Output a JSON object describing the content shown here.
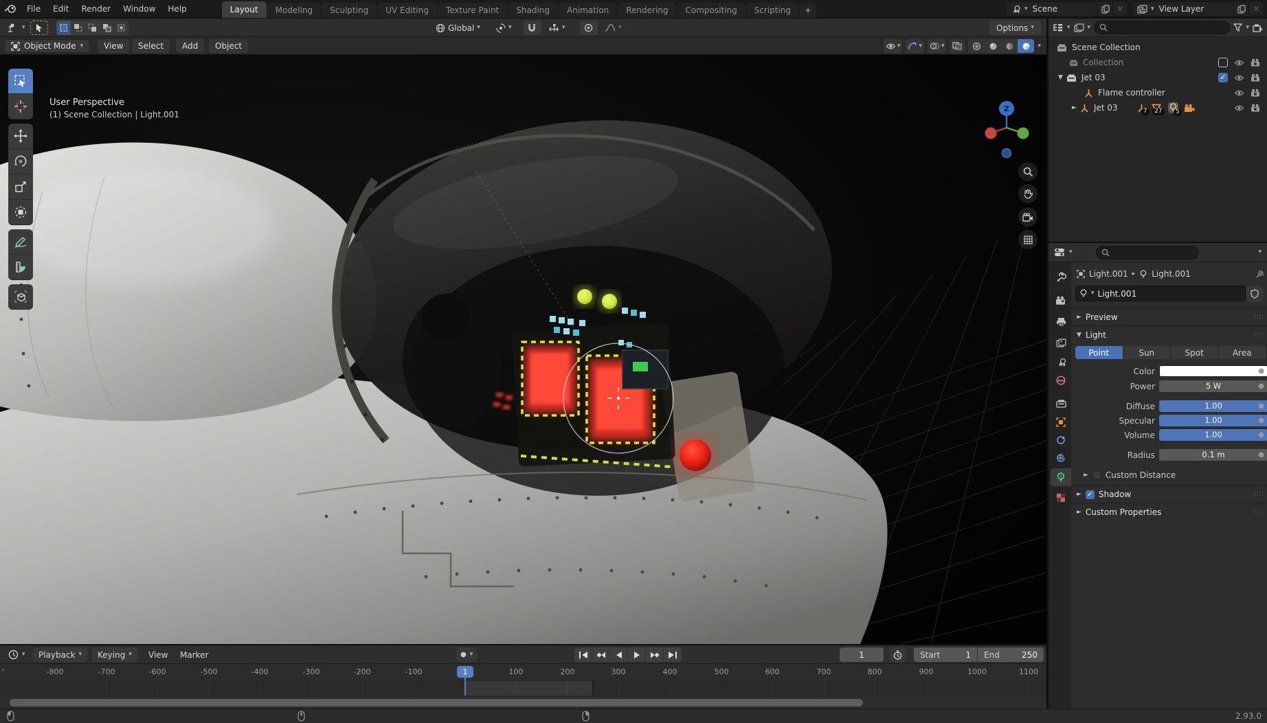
{
  "app": {
    "version": "2.93.0"
  },
  "topbar": {
    "menus": [
      "File",
      "Edit",
      "Render",
      "Window",
      "Help"
    ],
    "workspaces": [
      "Layout",
      "Modeling",
      "Sculpting",
      "UV Editing",
      "Texture Paint",
      "Shading",
      "Animation",
      "Rendering",
      "Compositing",
      "Scripting"
    ],
    "add_workspace": "+",
    "scene_label": "Scene",
    "view_layer_label": "View Layer"
  },
  "tool_settings": {
    "orientation": "Global",
    "options": "Options"
  },
  "viewport": {
    "mode": "Object Mode",
    "menu_view": "View",
    "menu_select": "Select",
    "menu_add": "Add",
    "menu_object": "Object",
    "overlay_line1": "User Perspective",
    "overlay_line2": "(1) Scene Collection | Light.001",
    "gizmo_z": "Z"
  },
  "outliner": {
    "root": "Scene Collection",
    "collection": "Collection",
    "jet_group": "Jet 03",
    "flame": "Flame controller",
    "jet_child": "Jet 03",
    "badge_empty": "7",
    "badge_mesh": "27",
    "badge_light": "5",
    "check_on": "✓"
  },
  "properties": {
    "breadcrumb_object": "Light.001",
    "breadcrumb_data": "Light.001",
    "name_value": "Light.001",
    "panel_preview": "Preview",
    "panel_light": "Light",
    "types": [
      "Point",
      "Sun",
      "Spot",
      "Area"
    ],
    "label_color": "Color",
    "label_power": "Power",
    "value_power": "5 W",
    "label_diffuse": "Diffuse",
    "value_diffuse": "1.00",
    "label_specular": "Specular",
    "value_specular": "1.00",
    "label_volume": "Volume",
    "value_volume": "1.00",
    "label_radius": "Radius",
    "value_radius": "0.1 m",
    "panel_custom_distance": "Custom Distance",
    "panel_shadow": "Shadow",
    "panel_custom_props": "Custom Properties",
    "shadow_check": "✓"
  },
  "timeline": {
    "menu_playback": "Playback",
    "menu_keying": "Keying",
    "menu_view": "View",
    "menu_marker": "Marker",
    "current_frame": "1",
    "start_label": "Start",
    "start_value": "1",
    "end_label": "End",
    "end_value": "250",
    "playhead_label": "1",
    "ruler": [
      "-800",
      "-700",
      "-600",
      "-500",
      "-400",
      "-300",
      "-200",
      "-100",
      "100",
      "200",
      "300",
      "400",
      "500",
      "600",
      "700",
      "800",
      "900",
      "1000",
      "1100"
    ]
  },
  "colors": {
    "accent_blue": "#4772b3",
    "active_tool_blue": "#5680c2",
    "icon_orange": "#e0933c",
    "light_data_green": "#58d08b",
    "slider_blue": "#4f74b8"
  }
}
